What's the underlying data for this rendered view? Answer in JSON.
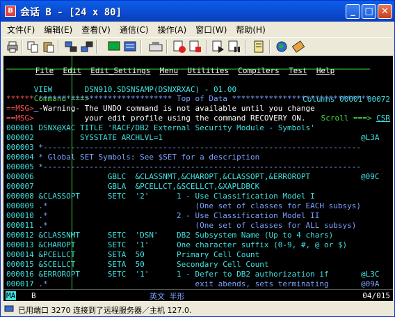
{
  "window": {
    "title": "会话 B - [24 x 80]"
  },
  "titlebar_buttons": [
    "_",
    "□",
    "✕"
  ],
  "menu": [
    "文件(F)",
    "编辑(E)",
    "查看(V)",
    "通信(C)",
    "操作(A)",
    "窗口(W)",
    "帮助(H)"
  ],
  "toolbar_icons": [
    "print-icon",
    "copy-icon",
    "paste-icon",
    "send-icon",
    "receive-icon",
    "display-icon",
    "map-icon",
    "keyboard-icon",
    "record-icon",
    "stop-icon",
    "play-icon",
    "pause-icon",
    "macro-icon",
    "globe-icon",
    "settings-icon"
  ],
  "ispf_menu": [
    "File",
    "Edit",
    "Edit_Settings",
    "Menu",
    "Utilities",
    "Compilers",
    "Test",
    "Help"
  ],
  "header": {
    "mode": "VIEW",
    "dataset": "DSN910.SDSNSAMP(DSNXRXAC) - 01.00",
    "columns": "Columns 00001 00072",
    "command_label": "Command ===>",
    "scroll_label": "Scroll ===>",
    "scroll_value": "CSR"
  },
  "lines": [
    {
      "num": "******",
      "text": " ***************************** Top of Data ******************************",
      "c": "r",
      "tc": "b"
    },
    {
      "num": "==MSG>",
      "text": " -Warning- The UNDO command is not available until you change",
      "c": "r",
      "tc": "w"
    },
    {
      "num": "==MSG>",
      "text": "           your edit profile using the command RECOVERY ON.",
      "c": "r",
      "tc": "w"
    },
    {
      "num": "000001",
      "text": " DSNX@XAC TITLE 'RACF/DB2 External Security Module - Symbols'",
      "c": "t",
      "tc": "t"
    },
    {
      "num": "000002",
      "text": "          SYSSTATE ARCHLVL=1                                           @L3A",
      "c": "t",
      "tc": "t"
    },
    {
      "num": "000003",
      "text": " *---------------------------------------------------------------------",
      "c": "t",
      "tc": "b"
    },
    {
      "num": "000004",
      "text": " * Global SET Symbols: See $SET for a description",
      "c": "t",
      "tc": "b"
    },
    {
      "num": "000005",
      "text": " *---------------------------------------------------------------------",
      "c": "t",
      "tc": "b"
    },
    {
      "num": "000006",
      "text": "                GBLC  &CLASSNMT,&CHAROPT,&CLASSOPT,&ERROROPT           @09C",
      "c": "t",
      "tc": "t"
    },
    {
      "num": "000007",
      "text": "                GBLA  &PCELLCT,&SCELLCT,&XAPLDBCK",
      "c": "t",
      "tc": "t"
    },
    {
      "num": "000008",
      "text": " &CLASSOPT      SETC  '2'      1 - Use Classification Model I",
      "c": "t",
      "tc": "t"
    },
    {
      "num": "000009",
      "text": " .*                                (One set of classes for EACH subsys)",
      "c": "t",
      "tc": "b"
    },
    {
      "num": "000010",
      "text": " .*                            2 - Use Classification Model II",
      "c": "t",
      "tc": "b"
    },
    {
      "num": "000011",
      "text": " .*                                (One set of classes for ALL subsys)",
      "c": "t",
      "tc": "b"
    },
    {
      "num": "000012",
      "text": " &CLASSNMT      SETC  'DSN'    DB2 Subsystem Name (Up to 4 chars)",
      "c": "t",
      "tc": "t"
    },
    {
      "num": "000013",
      "text": " &CHAROPT       SETC  '1'      One character suffix (0-9, #, @ or $)",
      "c": "t",
      "tc": "t"
    },
    {
      "num": "000014",
      "text": " &PCELLCT       SETA  50       Primary Cell Count",
      "c": "t",
      "tc": "t"
    },
    {
      "num": "000015",
      "text": " &SCELLCT       SETA  50       Secondary Cell Count",
      "c": "t",
      "tc": "t"
    },
    {
      "num": "000016",
      "text": " &ERROROPT      SETC  '1'      1 - Defer to DB2 authorization if       @L3C",
      "c": "t",
      "tc": "t"
    },
    {
      "num": "000017",
      "text": " .*                                exit abends, sets terminating       @09A",
      "c": "t",
      "tc": "b"
    }
  ],
  "oia": {
    "left": "MA",
    "session": "B",
    "ime": "英文 半形",
    "cursor": "04/015"
  },
  "status": {
    "text": "已用端口 3270 连接到了远程服务器／主机 127.0."
  },
  "colors": {
    "title_blue": "#0b4fd6",
    "terminal_bg": "#000000",
    "green": "#40e040",
    "turquoise": "#40e0e0",
    "red": "#ff5050",
    "blue": "#7aa0ff"
  }
}
